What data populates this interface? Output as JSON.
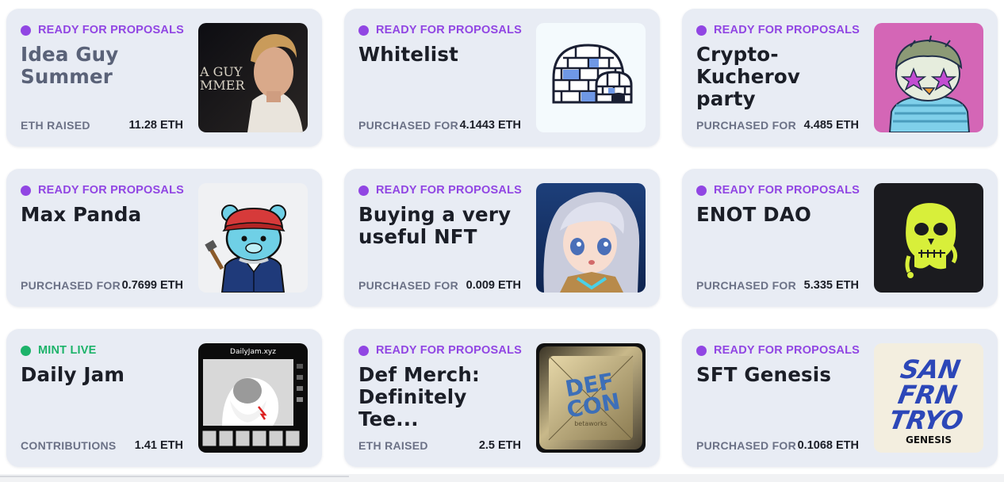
{
  "colors": {
    "ready": "#9146e3",
    "mint": "#1db36a",
    "card_bg": "#e8ecf4"
  },
  "cards": [
    {
      "status": "READY FOR PROPOSALS",
      "status_kind": "ready",
      "title": "Idea Guy Summer",
      "metric_label": "ETH RAISED",
      "metric_value": "11.28 ETH",
      "image": "idea-guy-summer-photo",
      "poster_text": "A GUY\nMMER"
    },
    {
      "status": "READY FOR PROPOSALS",
      "status_kind": "ready",
      "title": "Whitelist",
      "metric_label": "PURCHASED FOR",
      "metric_value": "4.1443 ETH",
      "image": "igloo-icon"
    },
    {
      "status": "READY FOR PROPOSALS",
      "status_kind": "ready",
      "title": "Crypto-\nKucherov party",
      "metric_label": "PURCHASED FOR",
      "metric_value": "4.485 ETH",
      "image": "penguin-nft"
    },
    {
      "status": "READY FOR PROPOSALS",
      "status_kind": "ready",
      "title": "Max Panda",
      "metric_label": "PURCHASED FOR",
      "metric_value": "0.7699 ETH",
      "image": "blue-bear-nft"
    },
    {
      "status": "READY FOR PROPOSALS",
      "status_kind": "ready",
      "title": "Buying a very useful NFT",
      "metric_label": "PURCHASED FOR",
      "metric_value": "0.009 ETH",
      "image": "anime-girl-nft"
    },
    {
      "status": "READY FOR PROPOSALS",
      "status_kind": "ready",
      "title": "ENOT DAO",
      "metric_label": "PURCHASED FOR",
      "metric_value": "5.335 ETH",
      "image": "ape-skull-nft"
    },
    {
      "status": "MINT LIVE",
      "status_kind": "mint",
      "title": "Daily Jam",
      "metric_label": "CONTRIBUTIONS",
      "metric_value": "1.41 ETH",
      "image": "daily-jam-screenshot",
      "image_caption": "DailyJam.xyz"
    },
    {
      "status": "READY FOR PROPOSALS",
      "status_kind": "ready",
      "title": "Def Merch: Definitely Tee...",
      "metric_label": "ETH RAISED",
      "metric_value": "2.5 ETH",
      "image": "defcon-nft",
      "image_text": "DEF\nCON",
      "image_sub": "betaworks"
    },
    {
      "status": "READY FOR PROPOSALS",
      "status_kind": "ready",
      "title": "SFT Genesis",
      "metric_label": "PURCHASED FOR",
      "metric_value": "0.1068 ETH",
      "image": "sf-genesis-nft",
      "image_text": "SAN\nFRN\nTRYO",
      "image_sub": "GENESIS"
    }
  ]
}
